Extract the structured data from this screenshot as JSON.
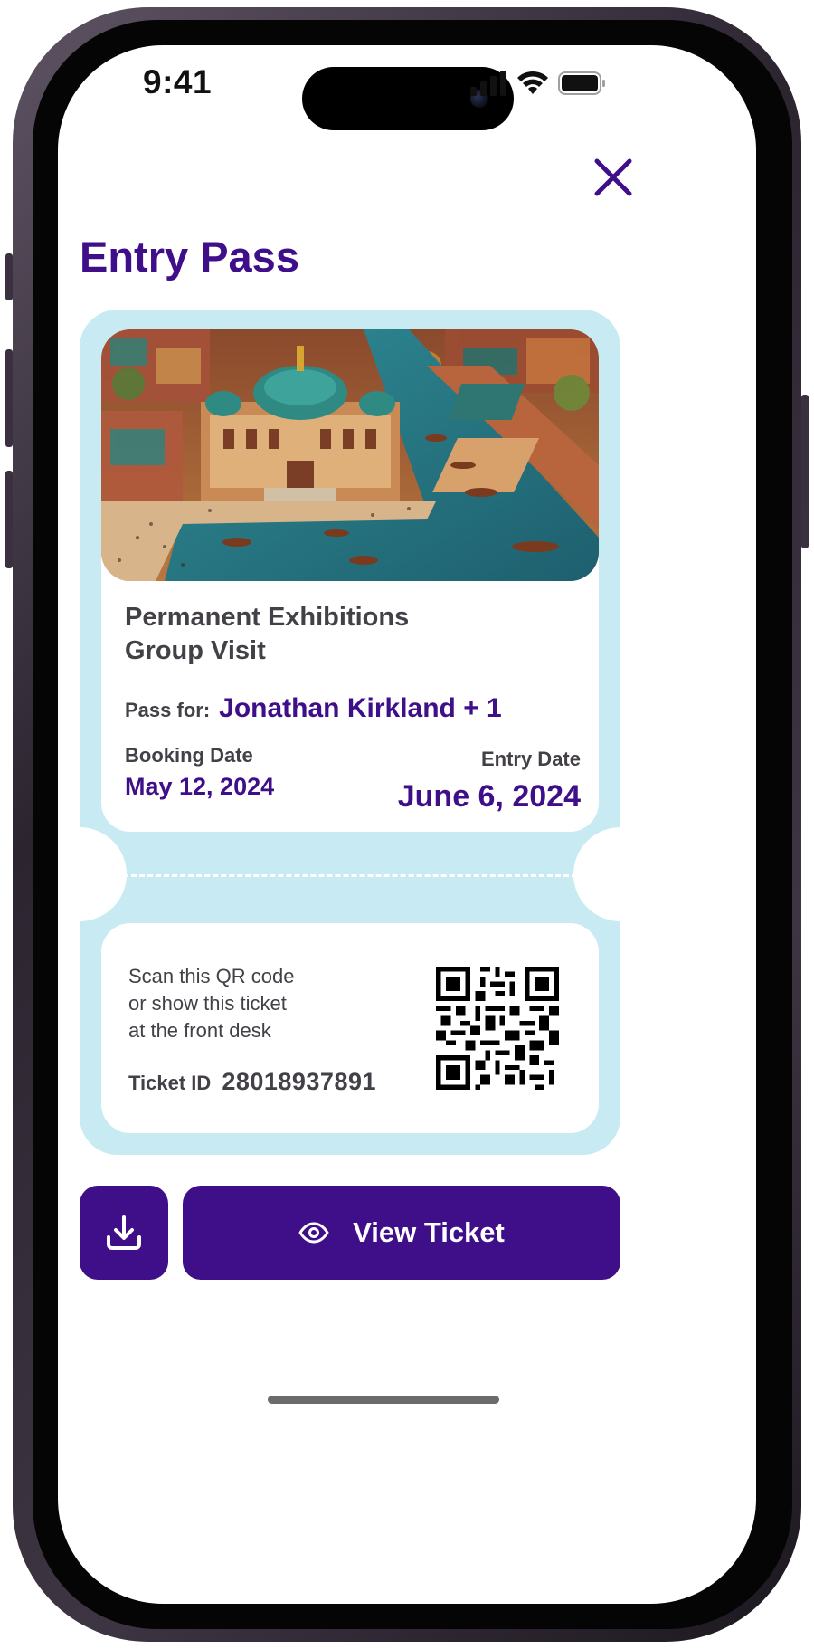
{
  "status_bar": {
    "time": "9:41"
  },
  "header": {
    "title": "Entry Pass"
  },
  "ticket": {
    "event_name_line1": "Permanent Exhibitions",
    "event_name_line2": "Group Visit",
    "pass_for_label": "Pass for:",
    "pass_for_name": "Jonathan Kirkland + 1",
    "booking_date_label": "Booking Date",
    "booking_date": "May 12, 2024",
    "entry_date_label": "Entry Date",
    "entry_date": "June 6, 2024",
    "scan_line1": "Scan this QR code",
    "scan_line2": "or show this ticket",
    "scan_line3": "at the front desk",
    "ticket_id_label": "Ticket ID",
    "ticket_id": "28018937891"
  },
  "actions": {
    "view_ticket_label": "View Ticket"
  },
  "icons": {
    "close": "close-icon",
    "download": "download-icon",
    "view": "eye-icon",
    "signal": "signal-icon",
    "wifi": "wifi-icon",
    "battery": "battery-icon"
  },
  "colors": {
    "accent": "#3f0f8a",
    "ticket_background": "#c8eaf2",
    "text_dark": "#444048"
  }
}
